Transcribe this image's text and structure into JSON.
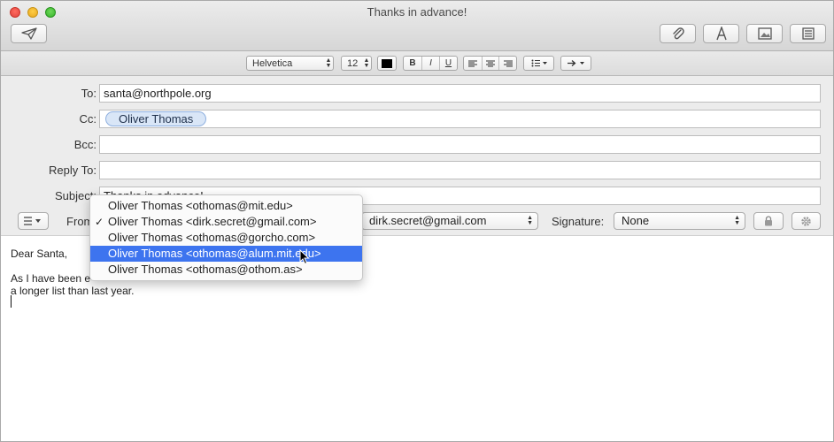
{
  "window": {
    "title": "Thanks in advance!"
  },
  "format_bar": {
    "font": "Helvetica",
    "size": "12",
    "bold": "B",
    "italic": "I",
    "underline": "U"
  },
  "fields": {
    "to": {
      "label": "To:",
      "value": "santa@northpole.org"
    },
    "cc": {
      "label": "Cc:",
      "token": "Oliver Thomas"
    },
    "bcc": {
      "label": "Bcc:",
      "value": ""
    },
    "reply_to": {
      "label": "Reply To:",
      "value": ""
    },
    "subject": {
      "label": "Subject:",
      "value": "Thanks in advance!"
    }
  },
  "bottom_row": {
    "from_label": "From:",
    "account_value": "dirk.secret@gmail.com",
    "signature_label": "Signature:",
    "signature_value": "None"
  },
  "from_menu": {
    "items": [
      "Oliver Thomas <othomas@mit.edu>",
      "Oliver Thomas <dirk.secret@gmail.com>",
      "Oliver Thomas <othomas@gorcho.com>",
      "Oliver Thomas <othomas@alum.mit.edu>",
      "Oliver Thomas <othomas@othom.as>"
    ],
    "checked_index": 1,
    "highlighted_index": 3,
    "check_mark": "✓"
  },
  "body": {
    "greeting": "Dear Santa,",
    "line1": "As I have been e",
    "line2": "a longer list than last year."
  },
  "colors": {
    "highlight": "#3d74ef",
    "token_bg": "#d9e6f7"
  },
  "icons": [
    "send-icon",
    "attachment-icon",
    "font-icon",
    "photo-icon",
    "template-icon",
    "lock-icon",
    "gear-icon",
    "list-icon",
    "chevron-down-icon"
  ]
}
